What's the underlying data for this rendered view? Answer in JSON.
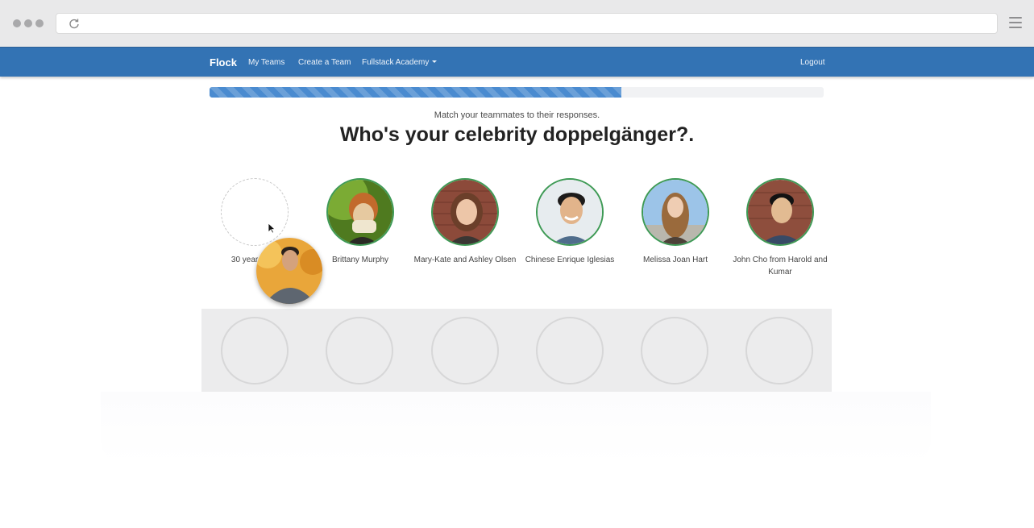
{
  "browser": {
    "window_dots": [
      "#a9a9ab",
      "#a9a9ab",
      "#a9a9ab"
    ],
    "address": ""
  },
  "nav": {
    "brand": "Flock",
    "links": [
      "My Teams",
      "Create a Team",
      "Fullstack Academy"
    ],
    "logout": "Logout",
    "color": "#3373b4"
  },
  "progress": {
    "fraction": 0.67,
    "color": "#4a8bd0"
  },
  "quiz": {
    "instructions": "Match your teammates to their responses.",
    "question": "Who's your celebrity doppelgänger?."
  },
  "celebrities": [
    {
      "label": "30 year old T",
      "state": "empty"
    },
    {
      "label": "Brittany Murphy",
      "state": "photo"
    },
    {
      "label": "Mary-Kate and Ashley Olsen",
      "state": "photo"
    },
    {
      "label": "Chinese Enrique Iglesias",
      "state": "photo"
    },
    {
      "label": "Melissa Joan Hart",
      "state": "photo"
    },
    {
      "label": "John Cho from Harold and Kumar",
      "state": "photo"
    }
  ],
  "drop_slots": 6,
  "accent": {
    "match_border": "#3e9a55"
  }
}
